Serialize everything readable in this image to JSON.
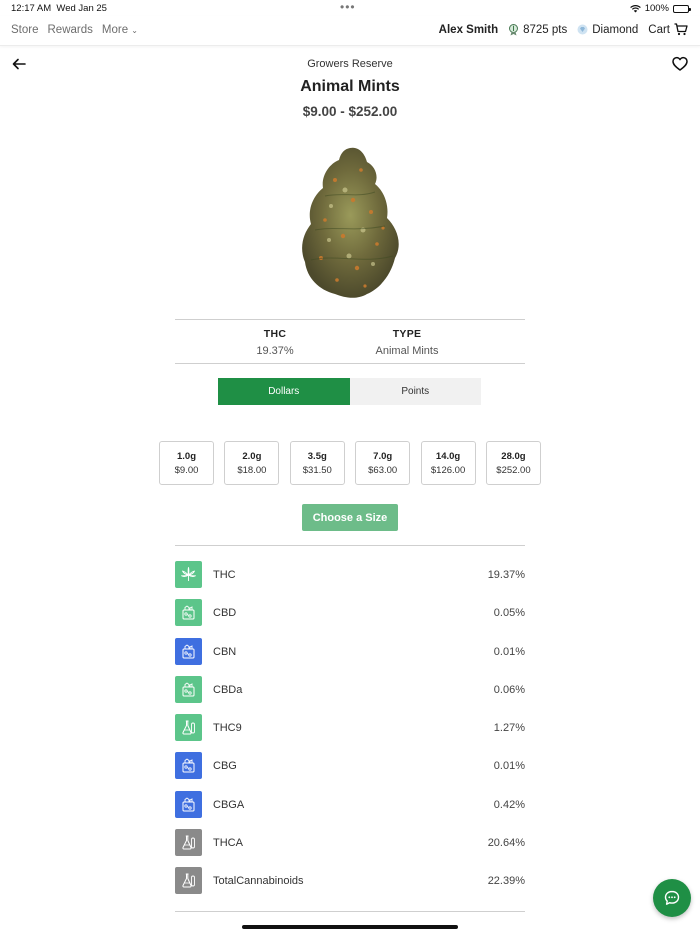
{
  "status_bar": {
    "time": "12:17 AM",
    "date": "Wed Jan 25",
    "battery": "100%"
  },
  "nav": {
    "store": "Store",
    "rewards": "Rewards",
    "more": "More",
    "user_name": "Alex Smith",
    "points": "8725 pts",
    "tier": "Diamond",
    "cart": "Cart"
  },
  "product": {
    "brand": "Growers Reserve",
    "name": "Animal Mints",
    "price_range": "$9.00 - $252.00"
  },
  "stats": {
    "thc_label": "THC",
    "thc_value": "19.37%",
    "type_label": "TYPE",
    "type_value": "Animal Mints"
  },
  "currency_toggle": {
    "dollars": "Dollars",
    "points": "Points",
    "selected": "Dollars"
  },
  "sizes": [
    {
      "weight": "1.0g",
      "price": "$9.00"
    },
    {
      "weight": "2.0g",
      "price": "$18.00"
    },
    {
      "weight": "3.5g",
      "price": "$31.50"
    },
    {
      "weight": "7.0g",
      "price": "$63.00"
    },
    {
      "weight": "14.0g",
      "price": "$126.00"
    },
    {
      "weight": "28.0g",
      "price": "$252.00"
    }
  ],
  "choose_button": "Choose a Size",
  "cannabinoids": [
    {
      "name": "THC",
      "value": "19.37%",
      "icon": "cannabis-leaf-icon",
      "color": "#5cc58a"
    },
    {
      "name": "CBD",
      "value": "0.05%",
      "icon": "molecule-box-icon",
      "color": "#5cc58a"
    },
    {
      "name": "CBN",
      "value": "0.01%",
      "icon": "molecule-box-icon",
      "color": "#3f6fe0"
    },
    {
      "name": "CBDa",
      "value": "0.06%",
      "icon": "molecule-box-icon",
      "color": "#5cc58a"
    },
    {
      "name": "THC9",
      "value": "1.27%",
      "icon": "flask-icon",
      "color": "#5cc58a"
    },
    {
      "name": "CBG",
      "value": "0.01%",
      "icon": "molecule-box-icon",
      "color": "#3f6fe0"
    },
    {
      "name": "CBGA",
      "value": "0.42%",
      "icon": "molecule-box-icon",
      "color": "#3f6fe0"
    },
    {
      "name": "THCA",
      "value": "20.64%",
      "icon": "flask-icon",
      "color": "#8a8a8a"
    },
    {
      "name": "TotalCannabinoids",
      "value": "22.39%",
      "icon": "flask-icon",
      "color": "#8a8a8a"
    }
  ],
  "colors": {
    "accent": "#1f8f45",
    "button_disabled": "#6dbc89"
  }
}
